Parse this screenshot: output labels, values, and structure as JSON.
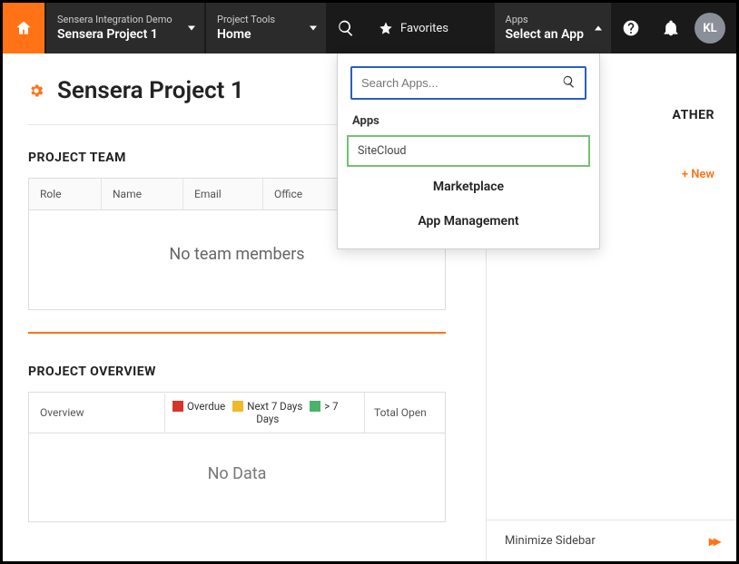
{
  "topbar": {
    "project_dropdown": {
      "small": "Sensera Integration Demo",
      "big": "Sensera Project 1"
    },
    "tools_dropdown": {
      "small": "Project Tools",
      "big": "Home"
    },
    "favorites_label": "Favorites",
    "apps_dropdown": {
      "small": "Apps",
      "big": "Select an App"
    },
    "avatar_initials": "KL"
  },
  "apps_panel": {
    "search_placeholder": "Search Apps...",
    "heading": "Apps",
    "item": "SiteCloud",
    "marketplace": "Marketplace",
    "management": "App Management"
  },
  "page": {
    "title": "Sensera Project 1"
  },
  "team": {
    "section_title": "PROJECT TEAM",
    "columns": {
      "role": "Role",
      "name": "Name",
      "email": "Email",
      "office": "Office"
    },
    "empty": "No team members"
  },
  "overview": {
    "section_title": "PROJECT OVERVIEW",
    "col_overview": "Overview",
    "legend": {
      "overdue": {
        "label": "Overdue",
        "color": "#d8352a"
      },
      "next7": {
        "label1": "Next 7 Days",
        "label2": "Days",
        "color": "#f1b92a"
      },
      "gt7": {
        "label": "> 7",
        "color": "#4bb36a"
      }
    },
    "col_total": "Total Open",
    "empty": "No Data"
  },
  "sidebar": {
    "weather_heading": "ATHER",
    "new_label": "+ New",
    "minimize_label": "Minimize Sidebar"
  }
}
